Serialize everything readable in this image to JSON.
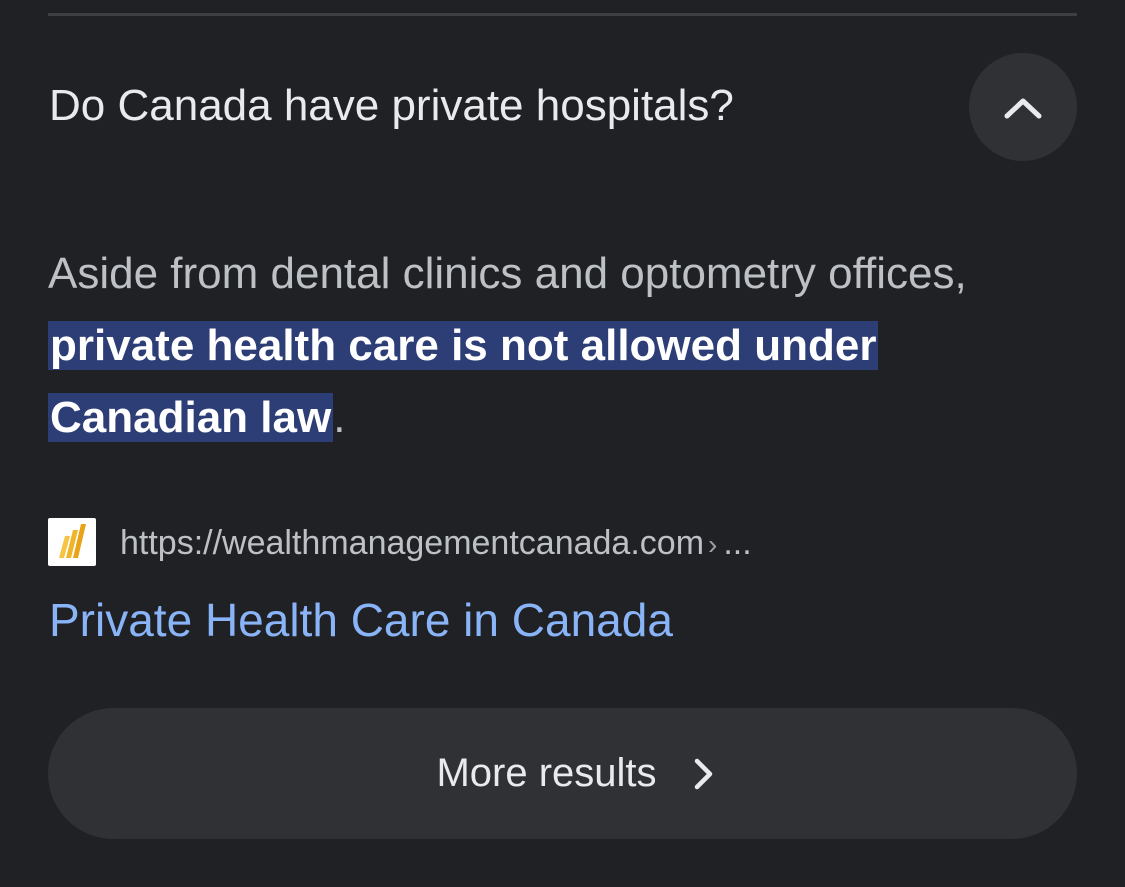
{
  "question": "Do Canada have private hospitals?",
  "collapse_icon": "chevron-up-icon",
  "answer": {
    "before": "Aside from dental clinics and optometry offices, ",
    "highlight": "private health care is not allowed under Canadian law",
    "after": "."
  },
  "source": {
    "favicon": "site-favicon-icon",
    "url": "https://wealthmanagementcanada.com",
    "separator": "›",
    "ellipsis": "..."
  },
  "result_title": "Private Health Care in Canada",
  "more_results": {
    "label": "More results",
    "icon": "chevron-right-icon"
  },
  "colors": {
    "background": "#202124",
    "link": "#8ab4f8",
    "highlight": "#2d3e76",
    "button": "#303134"
  }
}
